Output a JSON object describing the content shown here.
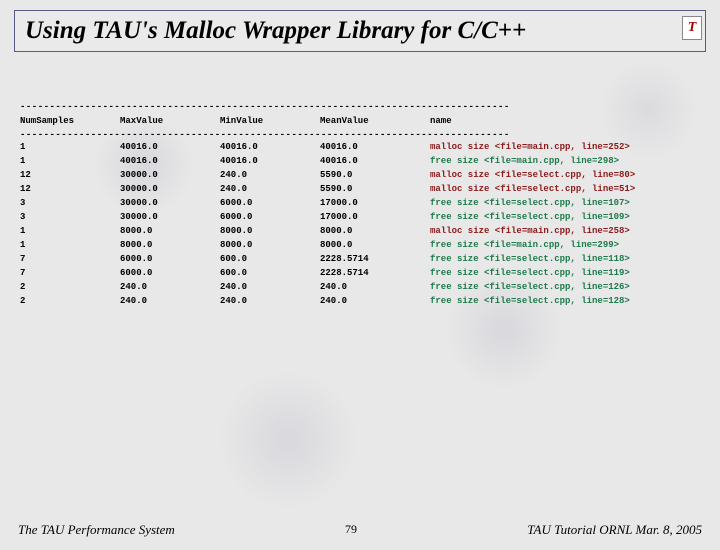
{
  "title": "Using TAU's Malloc Wrapper Library for C/C++",
  "logo": "T",
  "dashline": "-----------------------------------------------------------------------------------",
  "columns": {
    "numsamples": "NumSamples",
    "maxvalue": "MaxValue",
    "minvalue": "MinValue",
    "meanvalue": "MeanValue",
    "name": "name"
  },
  "rows": [
    {
      "ns": "1",
      "max": "40016.0",
      "min": "40016.0",
      "mean": "40016.0",
      "kind": "malloc",
      "name": "malloc size <file=main.cpp, line=252>"
    },
    {
      "ns": "1",
      "max": "40016.0",
      "min": "40016.0",
      "mean": "40016.0",
      "kind": "free",
      "name": "free size <file=main.cpp, line=298>"
    },
    {
      "ns": "12",
      "max": "30000.0",
      "min": "240.0",
      "mean": "5590.0",
      "kind": "malloc",
      "name": "malloc size <file=select.cpp, line=80>"
    },
    {
      "ns": "12",
      "max": "30000.0",
      "min": "240.0",
      "mean": "5590.0",
      "kind": "malloc",
      "name": "malloc size <file=select.cpp, line=51>"
    },
    {
      "ns": "3",
      "max": "30000.0",
      "min": "6000.0",
      "mean": "17000.0",
      "kind": "free",
      "name": "free size <file=select.cpp, line=107>"
    },
    {
      "ns": "3",
      "max": "30000.0",
      "min": "6000.0",
      "mean": "17000.0",
      "kind": "free",
      "name": "free size <file=select.cpp, line=109>"
    },
    {
      "ns": "1",
      "max": "8000.0",
      "min": "8000.0",
      "mean": "8000.0",
      "kind": "malloc",
      "name": "malloc size <file=main.cpp, line=258>"
    },
    {
      "ns": "1",
      "max": "8000.0",
      "min": "8000.0",
      "mean": "8000.0",
      "kind": "free",
      "name": "free size <file=main.cpp, line=299>"
    },
    {
      "ns": "7",
      "max": "6000.0",
      "min": "600.0",
      "mean": "2228.5714",
      "kind": "free",
      "name": "free size <file=select.cpp, line=118>"
    },
    {
      "ns": "7",
      "max": "6000.0",
      "min": "600.0",
      "mean": "2228.5714",
      "kind": "free",
      "name": "free size <file=select.cpp, line=119>"
    },
    {
      "ns": "2",
      "max": "240.0",
      "min": "240.0",
      "mean": "240.0",
      "kind": "free",
      "name": "free size <file=select.cpp, line=126>"
    },
    {
      "ns": "2",
      "max": "240.0",
      "min": "240.0",
      "mean": "240.0",
      "kind": "free",
      "name": "free size <file=select.cpp, line=128>"
    }
  ],
  "footer": {
    "left": "The TAU Performance System",
    "center": "79",
    "right": "TAU Tutorial ORNL Mar. 8, 2005"
  }
}
